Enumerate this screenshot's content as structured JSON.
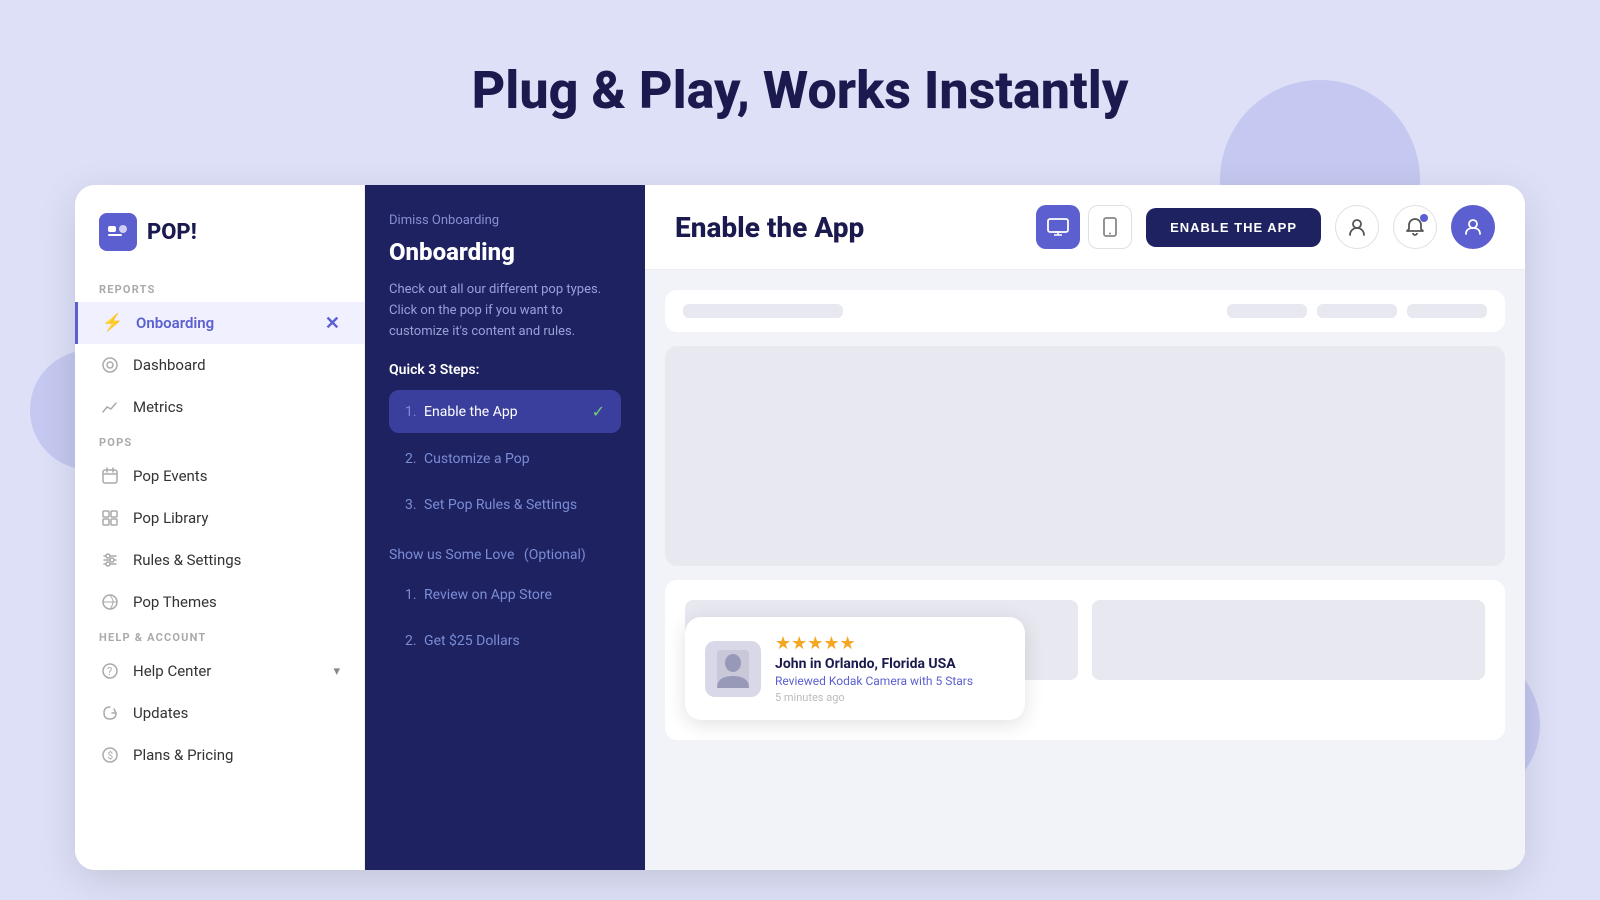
{
  "page": {
    "title": "Plug & Play, Works Instantly",
    "background_color": "#dde0f7"
  },
  "logo": {
    "text": "POP!",
    "icon": "💬"
  },
  "sidebar": {
    "sections": [
      {
        "label": "REPORTS",
        "items": [
          {
            "id": "onboarding",
            "label": "Onboarding",
            "icon": "⚡",
            "active": true
          },
          {
            "id": "dashboard",
            "label": "Dashboard",
            "icon": "⊙"
          },
          {
            "id": "metrics",
            "label": "Metrics",
            "icon": "📈"
          }
        ]
      },
      {
        "label": "POPS",
        "items": [
          {
            "id": "pop-events",
            "label": "Pop Events",
            "icon": "📅"
          },
          {
            "id": "pop-library",
            "label": "Pop Library",
            "icon": "⊞"
          },
          {
            "id": "rules-settings",
            "label": "Rules & Settings",
            "icon": "⚙"
          },
          {
            "id": "pop-themes",
            "label": "Pop Themes",
            "icon": "🎨"
          }
        ]
      },
      {
        "label": "HELP & ACCOUNT",
        "items": [
          {
            "id": "help-center",
            "label": "Help Center",
            "icon": "?",
            "has_chevron": true
          },
          {
            "id": "updates",
            "label": "Updates",
            "icon": "📡"
          },
          {
            "id": "plans-pricing",
            "label": "Plans & Pricing",
            "icon": "$"
          }
        ]
      }
    ]
  },
  "onboarding": {
    "dismiss_label": "Dimiss Onboarding",
    "title": "Onboarding",
    "description": "Check out all our different pop types. Click on the pop if you want to customize it's content and rules.",
    "steps_title": "Quick 3 Steps:",
    "steps": [
      {
        "num": "1.",
        "label": "Enable the App",
        "active": true,
        "done": true
      },
      {
        "num": "2.",
        "label": "Customize a Pop",
        "active": false,
        "done": false
      },
      {
        "num": "3.",
        "label": "Set Pop Rules & Settings",
        "active": false,
        "done": false
      }
    ],
    "love_section_title": "Show us Some Love",
    "love_optional": "(Optional)",
    "love_items": [
      {
        "num": "1.",
        "label": "Review on App Store"
      },
      {
        "num": "2.",
        "label": "Get $25 Dollars"
      }
    ]
  },
  "main": {
    "title": "Enable the App",
    "enable_button": "ENABLE THE APP",
    "devices": [
      {
        "id": "desktop",
        "icon": "🖥",
        "active": true
      },
      {
        "id": "mobile",
        "icon": "📱",
        "active": false
      }
    ],
    "header_icons": {
      "user_icon": "👤",
      "bell_icon": "🔔",
      "chat_icon": "💬"
    }
  },
  "review_card": {
    "avatar": "👔",
    "name": "John in Orlando, Florida USA",
    "text_prefix": "Reviewed Kodak Camera with",
    "highlight": "5 Stars",
    "time": "5 minutes ago",
    "stars": "★★★★★"
  }
}
